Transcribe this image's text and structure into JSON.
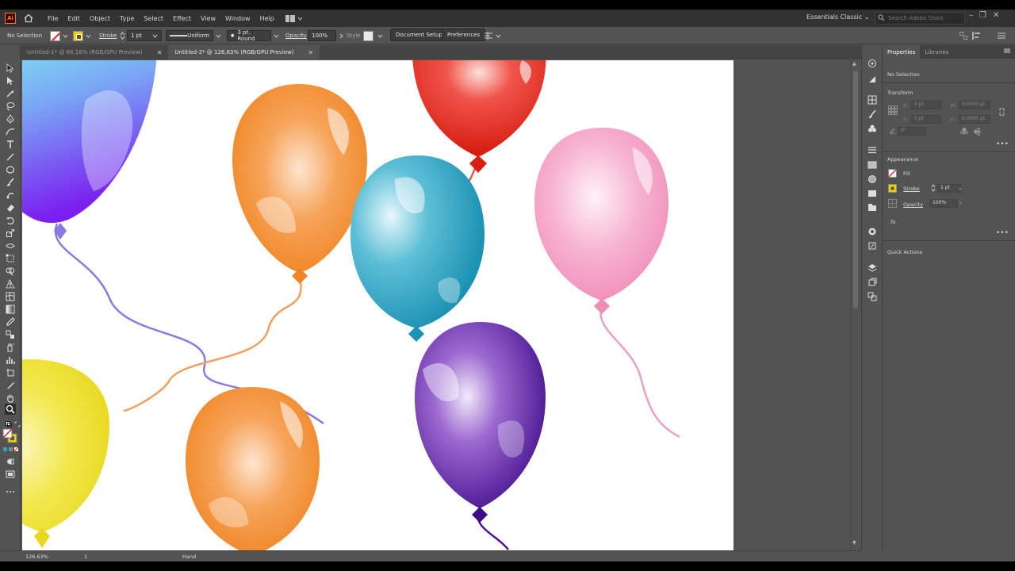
{
  "app": {
    "logo": "Ai",
    "menu": [
      "File",
      "Edit",
      "Object",
      "Type",
      "Select",
      "Effect",
      "View",
      "Window",
      "Help"
    ],
    "workspace": "Essentials Classic",
    "search_placeholder": "Search Adobe Stock"
  },
  "control_bar": {
    "selection": "No Selection",
    "stroke_label": "Stroke",
    "stroke_weight": "1 pt",
    "profile": "Uniform",
    "brush": "3 pt. Round",
    "opacity_label": "Opacity",
    "opacity": "100%",
    "style_label": "Style",
    "document_setup": "Document Setup",
    "preferences": "Preferences"
  },
  "tabs": [
    {
      "label": "Untitled-1* @ 66,16% (RGB/GPU Preview)",
      "active": false
    },
    {
      "label": "Untitled-2* @ 126,63% (RGB/GPU Preview)",
      "active": true
    }
  ],
  "status_bar": {
    "zoom": "126,63%",
    "artboard": "1",
    "tool": "Hand"
  },
  "properties": {
    "tabs": [
      "Properties",
      "Libraries"
    ],
    "selection": "No Selection",
    "transform_title": "Transform",
    "x_label": "X:",
    "y_label": "Y:",
    "w_label": "W:",
    "h_label": "H:",
    "x_value": "0 pt",
    "y_value": "0 pt",
    "w_value": "0,0000 pt",
    "h_value": "0,0000 pt",
    "angle_value": "0°",
    "appearance_title": "Appearance",
    "fill_label": "Fill",
    "stroke_label": "Stroke",
    "stroke_value": "1 pt",
    "opacity_label": "Opacity",
    "opacity_value": "100%",
    "fx_label": "fx.",
    "quick_actions": "Quick Actions"
  },
  "balloons": [
    {
      "color": "violet-cyan gradient",
      "name": "balloon-blue-purple"
    },
    {
      "color": "#f28a2a",
      "name": "balloon-orange-top"
    },
    {
      "color": "#e8291c",
      "name": "balloon-red"
    },
    {
      "color": "#2aa6c4",
      "name": "balloon-blue"
    },
    {
      "color": "#f29ac0",
      "name": "balloon-pink"
    },
    {
      "color": "#f1e23a",
      "name": "balloon-yellow"
    },
    {
      "color": "#f28a2a",
      "name": "balloon-orange-bottom"
    },
    {
      "color": "#4c1590",
      "name": "balloon-purple"
    }
  ]
}
